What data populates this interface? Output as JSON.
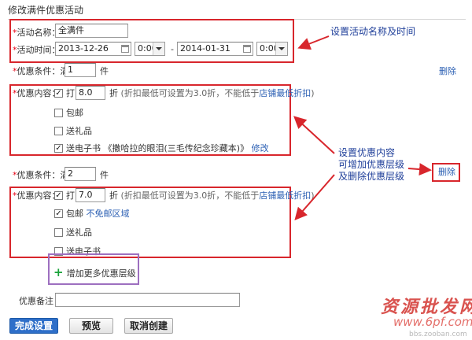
{
  "page": {
    "title": "修改满件优惠活动"
  },
  "activity": {
    "name_label": "活动名称：",
    "name_value": "全满件",
    "time_label": "活动时间：",
    "start_date": "2013-12-26",
    "start_time": "0:00",
    "separator": "-",
    "end_date": "2014-01-31",
    "end_time": "0:00"
  },
  "tier1": {
    "condition_label": "优惠条件：满",
    "quantity": "1",
    "unit": "件",
    "delete_link": "删除",
    "content_label": "优惠内容：",
    "discount_label": "打",
    "discount_value": "8.0",
    "discount_unit": "折",
    "discount_hint": "(折扣最低可设置为3.0折，不能低于",
    "discount_link": "店铺最低折扣",
    "discount_hint_end": ")",
    "free_shipping": {
      "label": "包邮",
      "checked": false
    },
    "gift": {
      "label": "送礼品",
      "checked": false
    },
    "ebook": {
      "label": "送电子书 《撒哈拉的眼泪(三毛传纪念珍藏本)》",
      "checked": true,
      "edit_link": "修改"
    },
    "discount_checked": true
  },
  "tier2": {
    "condition_label": "优惠条件：满",
    "quantity": "2",
    "unit": "件",
    "delete_link": "删除",
    "content_label": "优惠内容：",
    "discount_label": "打",
    "discount_value": "7.0",
    "discount_unit": "折",
    "discount_hint": "(折扣最低可设置为3.0折，不能低于",
    "discount_link": "店铺最低折扣",
    "discount_hint_end": ")",
    "free_shipping": {
      "label": "包邮",
      "checked": true,
      "extra_link": "不免邮区域"
    },
    "gift": {
      "label": "送礼品",
      "checked": false
    },
    "ebook": {
      "label": "送电子书",
      "checked": false
    },
    "discount_checked": true
  },
  "add_tier": {
    "label": "增加更多优惠层级"
  },
  "remark": {
    "label": "优惠备注：",
    "value": ""
  },
  "buttons": {
    "submit": "完成设置",
    "preview": "预览",
    "cancel": "取消创建"
  },
  "annotations": {
    "name_time": "设置活动名称及时间",
    "content_line1": "设置优惠内容",
    "content_line2": "可增加优惠层级",
    "content_line3": "及删除优惠层级"
  },
  "watermark": {
    "brand": "资源批发网",
    "site": "www.6pf.com",
    "sub": "bbs.zooban.com"
  },
  "colors": {
    "red_highlight": "#d8262c",
    "purple_highlight": "#9d6fc0",
    "link": "#2b5fb3",
    "primary": "#2e6fc9",
    "annotation": "#1f3f9a"
  }
}
